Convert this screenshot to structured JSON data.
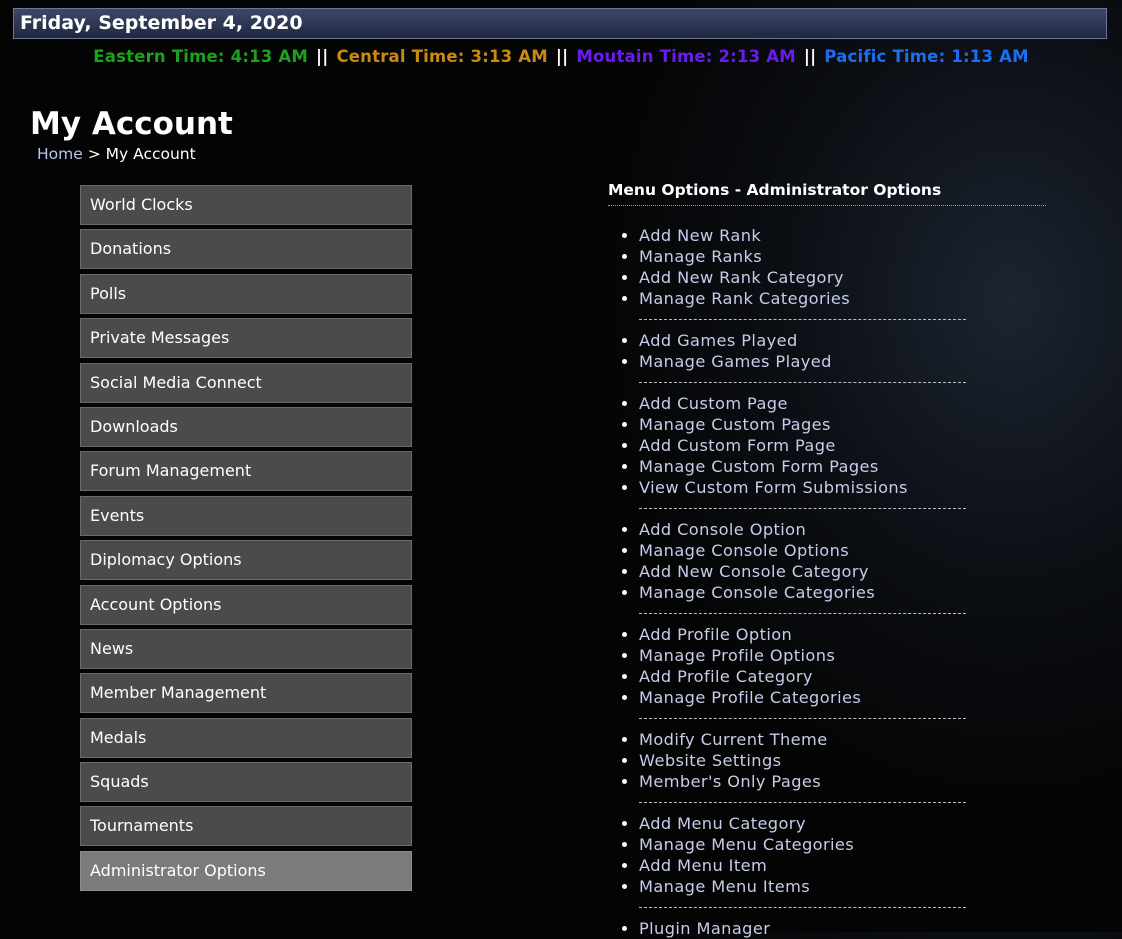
{
  "header": {
    "date": "Friday, September 4, 2020"
  },
  "clocks": [
    {
      "label": "Eastern Time: 4:13 AM",
      "color": "#1aa31a"
    },
    {
      "label": "Central Time: 3:13 AM",
      "color": "#c88a10"
    },
    {
      "label": "Moutain Time: 2:13 AM",
      "color": "#6a1cf0"
    },
    {
      "label": "Pacific Time: 1:13 AM",
      "color": "#1a6ef5"
    }
  ],
  "clock_separator": "||",
  "page": {
    "title": "My Account",
    "breadcrumb_home": "Home",
    "breadcrumb_sep": ">",
    "breadcrumb_current": "My Account"
  },
  "sidebar": {
    "items": [
      {
        "label": "World Clocks"
      },
      {
        "label": "Donations"
      },
      {
        "label": "Polls"
      },
      {
        "label": "Private Messages"
      },
      {
        "label": "Social Media Connect"
      },
      {
        "label": "Downloads"
      },
      {
        "label": "Forum Management"
      },
      {
        "label": "Events"
      },
      {
        "label": "Diplomacy Options"
      },
      {
        "label": "Account Options"
      },
      {
        "label": "News"
      },
      {
        "label": "Member Management"
      },
      {
        "label": "Medals"
      },
      {
        "label": "Squads"
      },
      {
        "label": "Tournaments"
      },
      {
        "label": "Administrator Options",
        "active": true
      }
    ]
  },
  "panel": {
    "title": "Menu Options - Administrator Options",
    "groups": [
      [
        "Add New Rank",
        "Manage Ranks",
        "Add New Rank Category",
        "Manage Rank Categories"
      ],
      [
        "Add Games Played",
        "Manage Games Played"
      ],
      [
        "Add Custom Page",
        "Manage Custom Pages",
        "Add Custom Form Page",
        "Manage Custom Form Pages",
        "View Custom Form Submissions"
      ],
      [
        "Add Console Option",
        "Manage Console Options",
        "Add New Console Category",
        "Manage Console Categories"
      ],
      [
        "Add Profile Option",
        "Manage Profile Options",
        "Add Profile Category",
        "Manage Profile Categories"
      ],
      [
        "Modify Current Theme",
        "Website Settings",
        "Member's Only Pages"
      ],
      [
        "Add Menu Category",
        "Manage Menu Categories",
        "Add Menu Item",
        "Manage Menu Items"
      ],
      [
        "Plugin Manager"
      ]
    ]
  }
}
